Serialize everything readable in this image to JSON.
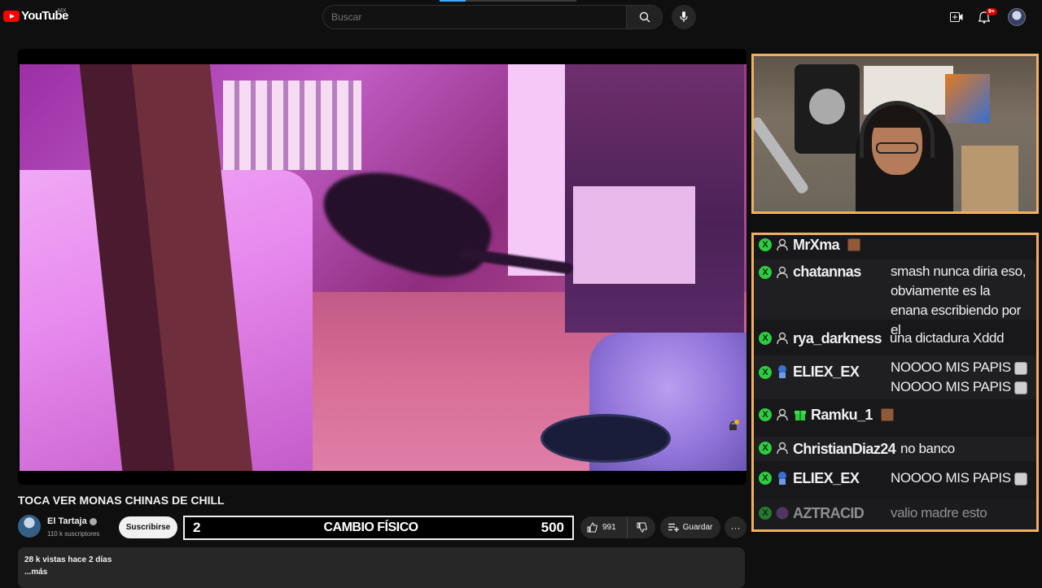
{
  "header": {
    "logo_text": "YouTube",
    "country": "MX",
    "search_placeholder": "Buscar",
    "notification_count": "9+"
  },
  "video": {
    "title": "TOCA VER MONAS CHINAS DE CHILL"
  },
  "channel": {
    "name": "El Tartaja",
    "subscribers": "110 k suscriptores",
    "subscribe_label": "Suscribirse"
  },
  "overlay": {
    "left": "2",
    "center": "CAMBIO FÍSICO",
    "right": "500"
  },
  "actions": {
    "like_count": "991",
    "save_label": "Guardar",
    "more_label": "···"
  },
  "description": {
    "stats": "28 k vistas  hace 2 días",
    "more": "...más"
  },
  "chat": {
    "messages": [
      {
        "user": "MrXma",
        "text": ""
      },
      {
        "user": "chatannas",
        "text": "smash nunca diria eso, obviamente es la enana escribiendo por el"
      },
      {
        "user": "rya_darkness",
        "text": "una dictadura Xddd"
      },
      {
        "user": "ELIEX_EX",
        "text": "NOOOO MIS PAPIS",
        "text2": "NOOOO MIS PAPIS"
      },
      {
        "user": "Ramku_1",
        "text": ""
      },
      {
        "user": "ChristianDiaz24",
        "text": "no banco"
      },
      {
        "user": "ELIEX_EX",
        "text": "NOOOO MIS PAPIS"
      },
      {
        "user": "AZTRACID",
        "text": "valio madre esto"
      }
    ]
  },
  "colors": {
    "accent": "#3ea6ff",
    "frame": "#f0b060",
    "badge": "#2ecc40",
    "brand": "#ff0000"
  }
}
